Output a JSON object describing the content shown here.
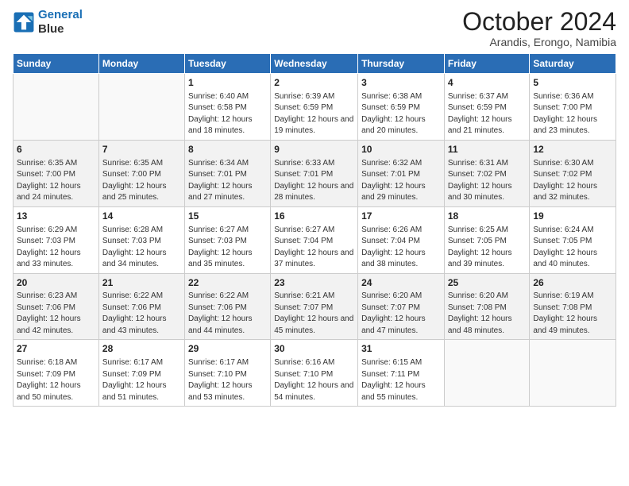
{
  "logo": {
    "line1": "General",
    "line2": "Blue"
  },
  "title": "October 2024",
  "subtitle": "Arandis, Erongo, Namibia",
  "days_header": [
    "Sunday",
    "Monday",
    "Tuesday",
    "Wednesday",
    "Thursday",
    "Friday",
    "Saturday"
  ],
  "weeks": [
    [
      {
        "num": "",
        "detail": ""
      },
      {
        "num": "",
        "detail": ""
      },
      {
        "num": "1",
        "detail": "Sunrise: 6:40 AM\nSunset: 6:58 PM\nDaylight: 12 hours and 18 minutes."
      },
      {
        "num": "2",
        "detail": "Sunrise: 6:39 AM\nSunset: 6:59 PM\nDaylight: 12 hours and 19 minutes."
      },
      {
        "num": "3",
        "detail": "Sunrise: 6:38 AM\nSunset: 6:59 PM\nDaylight: 12 hours and 20 minutes."
      },
      {
        "num": "4",
        "detail": "Sunrise: 6:37 AM\nSunset: 6:59 PM\nDaylight: 12 hours and 21 minutes."
      },
      {
        "num": "5",
        "detail": "Sunrise: 6:36 AM\nSunset: 7:00 PM\nDaylight: 12 hours and 23 minutes."
      }
    ],
    [
      {
        "num": "6",
        "detail": "Sunrise: 6:35 AM\nSunset: 7:00 PM\nDaylight: 12 hours and 24 minutes."
      },
      {
        "num": "7",
        "detail": "Sunrise: 6:35 AM\nSunset: 7:00 PM\nDaylight: 12 hours and 25 minutes."
      },
      {
        "num": "8",
        "detail": "Sunrise: 6:34 AM\nSunset: 7:01 PM\nDaylight: 12 hours and 27 minutes."
      },
      {
        "num": "9",
        "detail": "Sunrise: 6:33 AM\nSunset: 7:01 PM\nDaylight: 12 hours and 28 minutes."
      },
      {
        "num": "10",
        "detail": "Sunrise: 6:32 AM\nSunset: 7:01 PM\nDaylight: 12 hours and 29 minutes."
      },
      {
        "num": "11",
        "detail": "Sunrise: 6:31 AM\nSunset: 7:02 PM\nDaylight: 12 hours and 30 minutes."
      },
      {
        "num": "12",
        "detail": "Sunrise: 6:30 AM\nSunset: 7:02 PM\nDaylight: 12 hours and 32 minutes."
      }
    ],
    [
      {
        "num": "13",
        "detail": "Sunrise: 6:29 AM\nSunset: 7:03 PM\nDaylight: 12 hours and 33 minutes."
      },
      {
        "num": "14",
        "detail": "Sunrise: 6:28 AM\nSunset: 7:03 PM\nDaylight: 12 hours and 34 minutes."
      },
      {
        "num": "15",
        "detail": "Sunrise: 6:27 AM\nSunset: 7:03 PM\nDaylight: 12 hours and 35 minutes."
      },
      {
        "num": "16",
        "detail": "Sunrise: 6:27 AM\nSunset: 7:04 PM\nDaylight: 12 hours and 37 minutes."
      },
      {
        "num": "17",
        "detail": "Sunrise: 6:26 AM\nSunset: 7:04 PM\nDaylight: 12 hours and 38 minutes."
      },
      {
        "num": "18",
        "detail": "Sunrise: 6:25 AM\nSunset: 7:05 PM\nDaylight: 12 hours and 39 minutes."
      },
      {
        "num": "19",
        "detail": "Sunrise: 6:24 AM\nSunset: 7:05 PM\nDaylight: 12 hours and 40 minutes."
      }
    ],
    [
      {
        "num": "20",
        "detail": "Sunrise: 6:23 AM\nSunset: 7:06 PM\nDaylight: 12 hours and 42 minutes."
      },
      {
        "num": "21",
        "detail": "Sunrise: 6:22 AM\nSunset: 7:06 PM\nDaylight: 12 hours and 43 minutes."
      },
      {
        "num": "22",
        "detail": "Sunrise: 6:22 AM\nSunset: 7:06 PM\nDaylight: 12 hours and 44 minutes."
      },
      {
        "num": "23",
        "detail": "Sunrise: 6:21 AM\nSunset: 7:07 PM\nDaylight: 12 hours and 45 minutes."
      },
      {
        "num": "24",
        "detail": "Sunrise: 6:20 AM\nSunset: 7:07 PM\nDaylight: 12 hours and 47 minutes."
      },
      {
        "num": "25",
        "detail": "Sunrise: 6:20 AM\nSunset: 7:08 PM\nDaylight: 12 hours and 48 minutes."
      },
      {
        "num": "26",
        "detail": "Sunrise: 6:19 AM\nSunset: 7:08 PM\nDaylight: 12 hours and 49 minutes."
      }
    ],
    [
      {
        "num": "27",
        "detail": "Sunrise: 6:18 AM\nSunset: 7:09 PM\nDaylight: 12 hours and 50 minutes."
      },
      {
        "num": "28",
        "detail": "Sunrise: 6:17 AM\nSunset: 7:09 PM\nDaylight: 12 hours and 51 minutes."
      },
      {
        "num": "29",
        "detail": "Sunrise: 6:17 AM\nSunset: 7:10 PM\nDaylight: 12 hours and 53 minutes."
      },
      {
        "num": "30",
        "detail": "Sunrise: 6:16 AM\nSunset: 7:10 PM\nDaylight: 12 hours and 54 minutes."
      },
      {
        "num": "31",
        "detail": "Sunrise: 6:15 AM\nSunset: 7:11 PM\nDaylight: 12 hours and 55 minutes."
      },
      {
        "num": "",
        "detail": ""
      },
      {
        "num": "",
        "detail": ""
      }
    ]
  ]
}
